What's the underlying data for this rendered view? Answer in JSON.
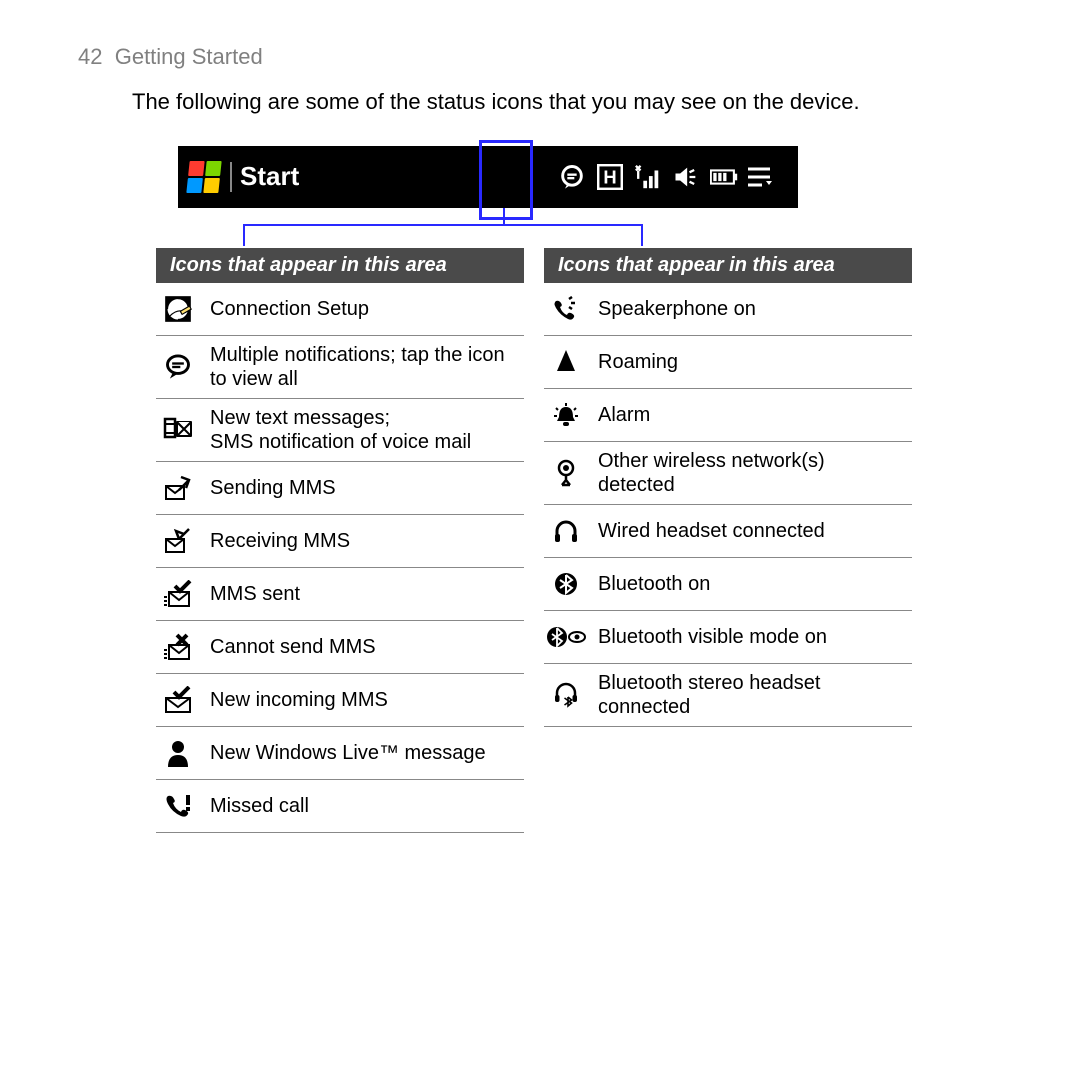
{
  "header": {
    "page_number": "42",
    "section": "Getting Started"
  },
  "intro": "The following are some of the status icons that you may see on the device.",
  "statusbar": {
    "start_label": "Start",
    "icons": [
      "notification-bubble",
      "H-indicator",
      "signal",
      "speaker",
      "battery",
      "task-switcher"
    ]
  },
  "column_header": "Icons that appear in this area",
  "left_column": [
    {
      "icon": "connection-setup-icon",
      "label": "Connection Setup"
    },
    {
      "icon": "notification-bubble-icon",
      "label": "Multiple notifications; tap the icon to view all"
    },
    {
      "icon": "sms-icon",
      "label": "New text messages;\nSMS notification of voice mail"
    },
    {
      "icon": "sending-mms-icon",
      "label": "Sending MMS"
    },
    {
      "icon": "receiving-mms-icon",
      "label": "Receiving MMS"
    },
    {
      "icon": "mms-sent-icon",
      "label": "MMS sent"
    },
    {
      "icon": "mms-fail-icon",
      "label": "Cannot send MMS"
    },
    {
      "icon": "mms-incoming-icon",
      "label": "New incoming MMS"
    },
    {
      "icon": "windows-live-icon",
      "label": "New Windows Live™ message"
    },
    {
      "icon": "missed-call-icon",
      "label": "Missed call"
    }
  ],
  "right_column": [
    {
      "icon": "speakerphone-icon",
      "label": "Speakerphone on"
    },
    {
      "icon": "roaming-icon",
      "label": "Roaming"
    },
    {
      "icon": "alarm-icon",
      "label": "Alarm"
    },
    {
      "icon": "wifi-detect-icon",
      "label": "Other wireless network(s) detected"
    },
    {
      "icon": "wired-headset-icon",
      "label": "Wired headset connected"
    },
    {
      "icon": "bluetooth-icon",
      "label": "Bluetooth on"
    },
    {
      "icon": "bluetooth-visible-icon",
      "label": "Bluetooth visible mode on"
    },
    {
      "icon": "bt-headset-icon",
      "label": "Bluetooth stereo headset connected"
    }
  ]
}
